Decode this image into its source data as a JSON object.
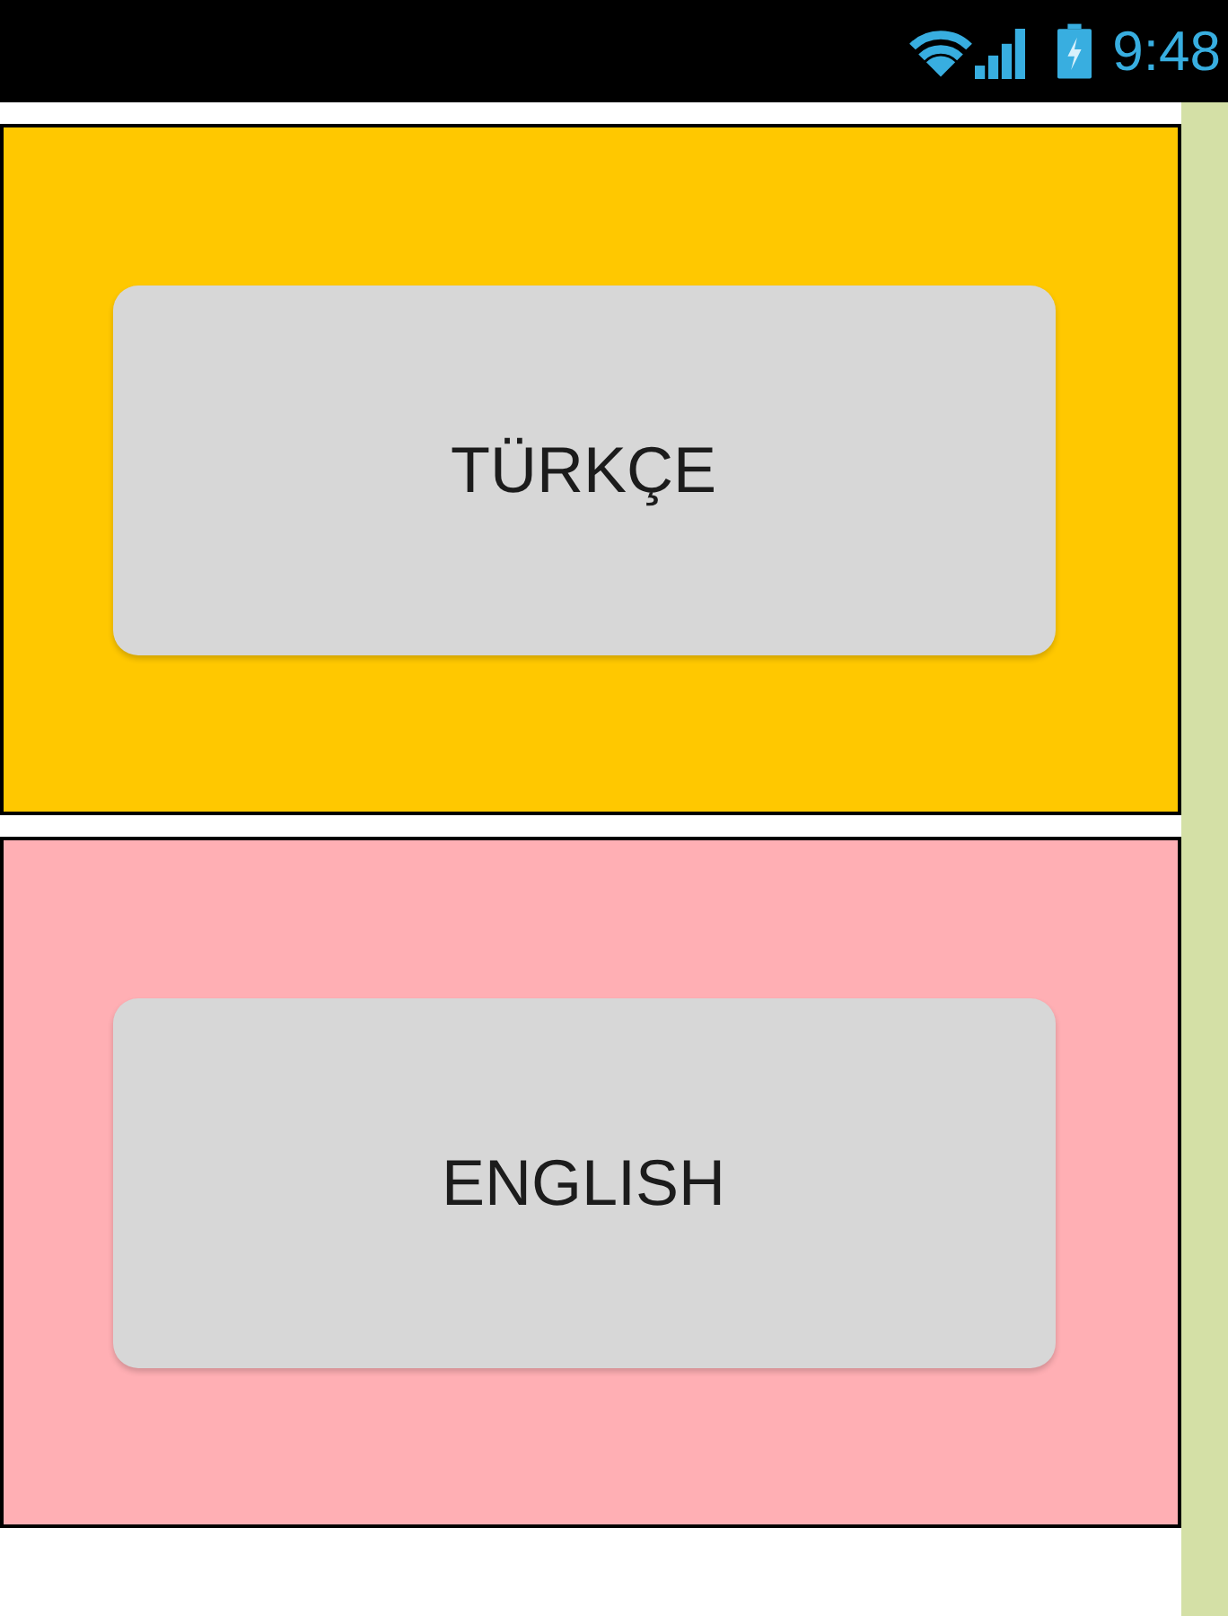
{
  "status_bar": {
    "time": "9:48"
  },
  "language_panels": [
    {
      "label": "TÜRKÇE",
      "color": "#ffc800"
    },
    {
      "label": "ENGLISH",
      "color": "#ffafb4"
    }
  ]
}
